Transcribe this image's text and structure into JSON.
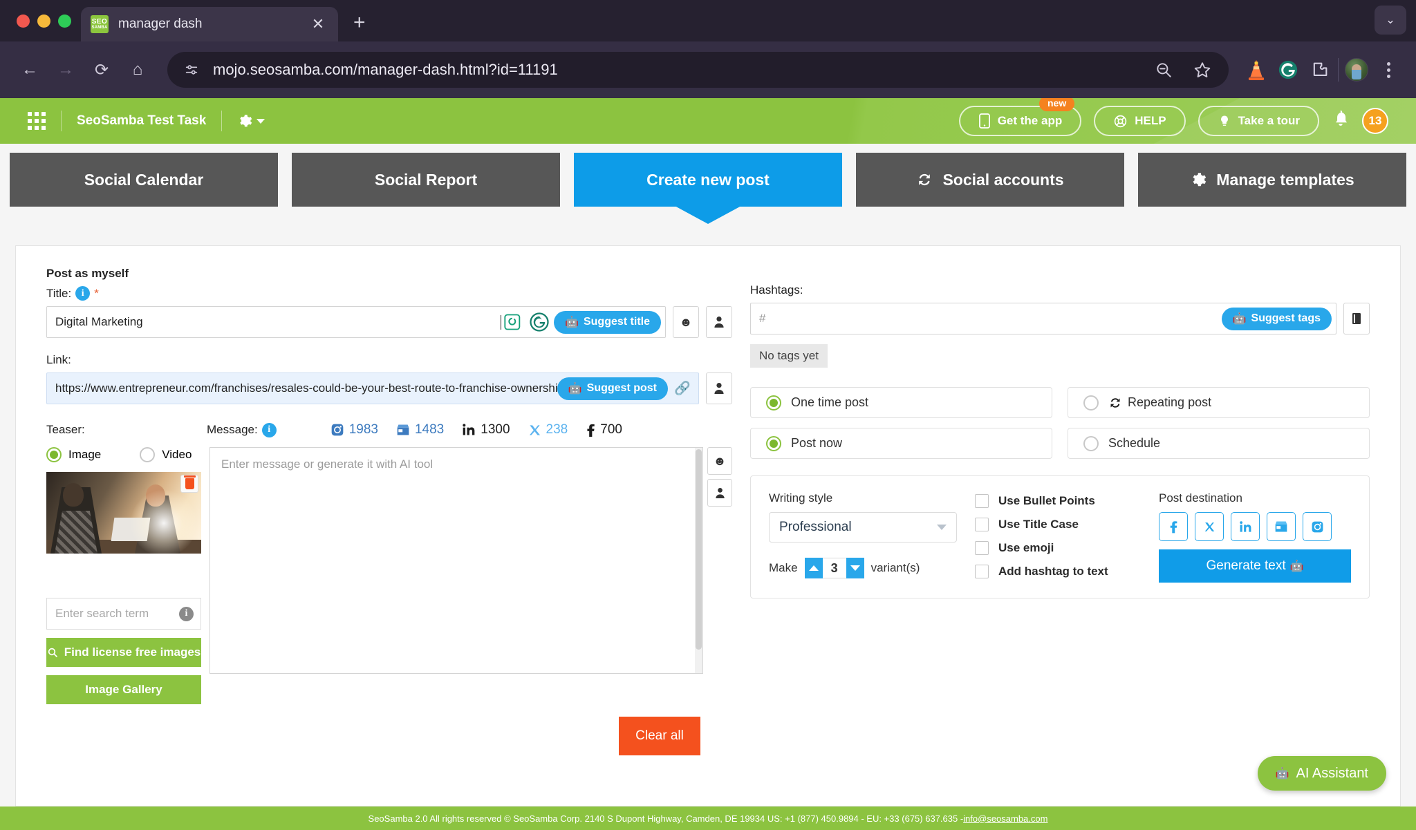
{
  "browser": {
    "tab": {
      "title": "manager dash",
      "favicon_line1": "SEO",
      "favicon_line2": "SAMBA",
      "close": "✕"
    },
    "new_tab": "+",
    "collapse": "⌄",
    "url": "mojo.seosamba.com/manager-dash.html?id=11191",
    "nav": {
      "back": "←",
      "forward": "→",
      "reload": "⟳",
      "home": "⌂"
    },
    "toolbar_icons": [
      "zoom-out-icon",
      "bookmark-star-icon",
      "traffic-cone-extension-icon",
      "grammarly-icon",
      "extensions-icon",
      "profile-avatar",
      "chrome-menu-icon"
    ]
  },
  "appbar": {
    "title": "SeoSamba Test Task",
    "get_app": "Get the app",
    "new_badge": "new",
    "help": "HELP",
    "tour": "Take a tour",
    "notification_count": "13"
  },
  "tabs": [
    {
      "label": "Social Calendar",
      "icon": "",
      "active": false
    },
    {
      "label": "Social Report",
      "icon": "",
      "active": false
    },
    {
      "label": "Create new post",
      "icon": "",
      "active": true
    },
    {
      "label": "Social accounts",
      "icon": "sync-icon",
      "active": false
    },
    {
      "label": "Manage templates",
      "icon": "gear-icon",
      "active": false
    }
  ],
  "form": {
    "post_as": "Post as myself",
    "title_label": "Title:",
    "title_required": "*",
    "title_value": "Digital Marketing",
    "suggest_title": "Suggest title",
    "link_label": "Link:",
    "link_value": "https://www.entrepreneur.com/franchises/resales-could-be-your-best-route-to-franchise-ownership",
    "suggest_post": "Suggest post",
    "teaser_label": "Teaser:",
    "message_label": "Message:",
    "teaser_image": "Image",
    "teaser_video": "Video",
    "message_placeholder": "Enter message or generate it with AI tool",
    "image_search_placeholder": "Enter search term",
    "find_images": "Find license free images",
    "image_gallery": "Image Gallery",
    "clear_all": "Clear all",
    "counts": [
      {
        "network": "instagram",
        "value": "1983"
      },
      {
        "network": "google-business",
        "value": "1483"
      },
      {
        "network": "linkedin",
        "value": "1300"
      },
      {
        "network": "x-twitter",
        "value": "238"
      },
      {
        "network": "facebook",
        "value": "700"
      }
    ]
  },
  "hashtags": {
    "label": "Hashtags:",
    "placeholder": "#",
    "suggest_tags": "Suggest tags",
    "no_tags": "No tags yet"
  },
  "post_options": [
    {
      "label": "One time post",
      "selected": true,
      "icon": ""
    },
    {
      "label": "Repeating post",
      "selected": false,
      "icon": "sync-icon"
    },
    {
      "label": "Post now",
      "selected": true,
      "icon": ""
    },
    {
      "label": "Schedule",
      "selected": false,
      "icon": ""
    }
  ],
  "ai_panel": {
    "writing_style_label": "Writing style",
    "writing_style_value": "Professional",
    "make_label": "Make",
    "variants_value": "3",
    "variants_label": "variant(s)",
    "checkboxes": [
      {
        "label": "Use Bullet Points",
        "checked": false
      },
      {
        "label": "Use Title Case",
        "checked": false
      },
      {
        "label": "Use emoji",
        "checked": false
      },
      {
        "label": "Add hashtag to text",
        "checked": false
      }
    ],
    "destination_label": "Post destination",
    "destinations": [
      {
        "name": "facebook",
        "glyph": "f"
      },
      {
        "name": "x-twitter",
        "glyph": "𝕏"
      },
      {
        "name": "linkedin",
        "glyph": "in"
      },
      {
        "name": "google-business",
        "glyph": "▤"
      },
      {
        "name": "instagram",
        "glyph": "⊙"
      }
    ],
    "generate_text": "Generate text"
  },
  "ai_assistant": "AI Assistant",
  "footer": {
    "text": "SeoSamba 2.0  All rights reserved © SeoSamba Corp. 2140 S Dupont Highway, Camden, DE 19934 US: +1 (877) 450.9894 - EU: +33 (675) 637.635 - ",
    "email": "info@seosamba.com"
  },
  "colors": {
    "brand_green": "#8cc340",
    "accent_blue": "#29a7ea",
    "active_tab": "#0d9ce8",
    "danger": "#f4511e"
  }
}
